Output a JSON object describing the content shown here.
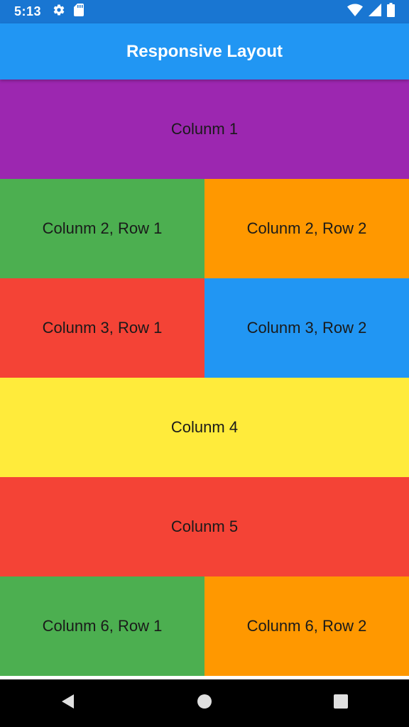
{
  "status_bar": {
    "time": "5:13",
    "icons": [
      "gear-icon",
      "sd-card-icon",
      "wifi-icon",
      "signal-icon",
      "battery-icon"
    ],
    "color": "#1976D2"
  },
  "app_bar": {
    "title": "Responsive Layout",
    "color": "#2196F3"
  },
  "layout": {
    "rows": [
      {
        "cells": [
          {
            "label": "Colunm 1",
            "color": "#9C27B0"
          }
        ]
      },
      {
        "cells": [
          {
            "label": "Colunm 2, Row 1",
            "color": "#4CAF50"
          },
          {
            "label": "Colunm 2, Row 2",
            "color": "#FF9800"
          }
        ]
      },
      {
        "cells": [
          {
            "label": "Colunm 3, Row 1",
            "color": "#F44336"
          },
          {
            "label": "Colunm 3, Row 2",
            "color": "#2196F3"
          }
        ]
      },
      {
        "cells": [
          {
            "label": "Colunm 4",
            "color": "#FFEB3B"
          }
        ]
      },
      {
        "cells": [
          {
            "label": "Colunm 5",
            "color": "#F44336"
          }
        ]
      },
      {
        "cells": [
          {
            "label": "Colunm 6, Row 1",
            "color": "#4CAF50"
          },
          {
            "label": "Colunm 6, Row 2",
            "color": "#FF9800"
          }
        ]
      }
    ]
  },
  "nav_bar": {
    "buttons": [
      "back-icon",
      "home-icon",
      "recents-icon"
    ]
  }
}
